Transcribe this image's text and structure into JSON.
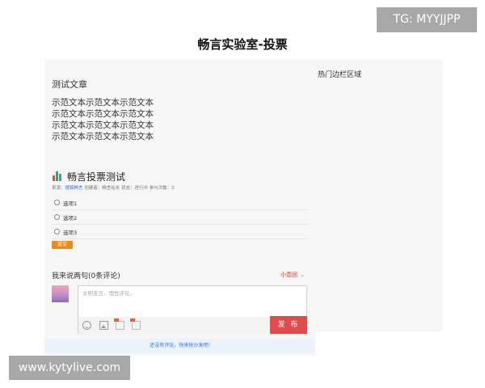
{
  "badges": {
    "tg": "TG: MYYJJPP",
    "site": "www.kytylive.com"
  },
  "page": {
    "title": "畅言实验室-投票"
  },
  "article": {
    "title": "测试文章",
    "lines": [
      "示范文本示范文本示范文本",
      "示范文本示范文本示范文本",
      "示范文本示范文本示范文本",
      "示范文本示范文本示范文本"
    ]
  },
  "sidebar": {
    "title": "热门边栏区域"
  },
  "vote": {
    "title": "畅言投票测试",
    "meta_prefix": "来源：",
    "meta_link": "搜狐畅言",
    "meta_rest": " 创建者：畅言站长 状态：进行中 参与次数：0",
    "options": [
      "选项1",
      "选项2",
      "选项3"
    ],
    "submit": "提交",
    "icon": "bar-chart-icon",
    "icon_colors": [
      "#e74c3c",
      "#27ae60",
      "#3498db"
    ]
  },
  "comments": {
    "heading": "我来说两句(0条评论)",
    "sort": "小壶回",
    "placeholder": "文明发言，理性评论。",
    "publish": "发 布",
    "empty": "还没有评论，快来抢沙发吧!"
  },
  "colors": {
    "accent_red": "#e14b4e",
    "submit_orange": "#e88b1f",
    "link_blue": "#3a6fc4"
  }
}
